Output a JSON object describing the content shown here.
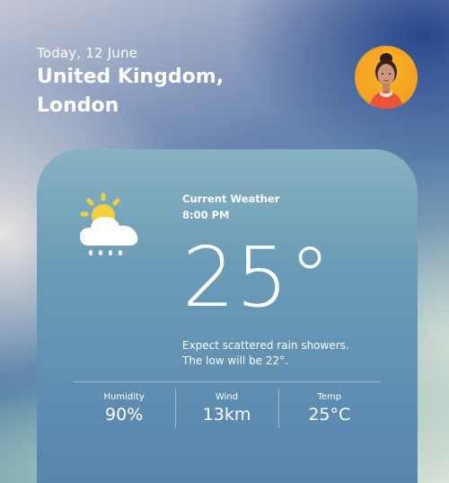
{
  "header": {
    "date": "Today, 12 June",
    "location_line1": "United Kingdom,",
    "location_line2": "London"
  },
  "user": {
    "avatar_icon": "user-avatar"
  },
  "current": {
    "title": "Current Weather",
    "time": "8:00 PM",
    "temperature": "25°",
    "description_line1": "Expect scattered rain showers.",
    "description_line2": "The low will be 22°.",
    "condition_icon": "partly-cloudy-rain-icon"
  },
  "stats": [
    {
      "label": "Humidity",
      "value": "90%"
    },
    {
      "label": "Wind",
      "value": "13km"
    },
    {
      "label": "Temp",
      "value": "25°C"
    }
  ]
}
